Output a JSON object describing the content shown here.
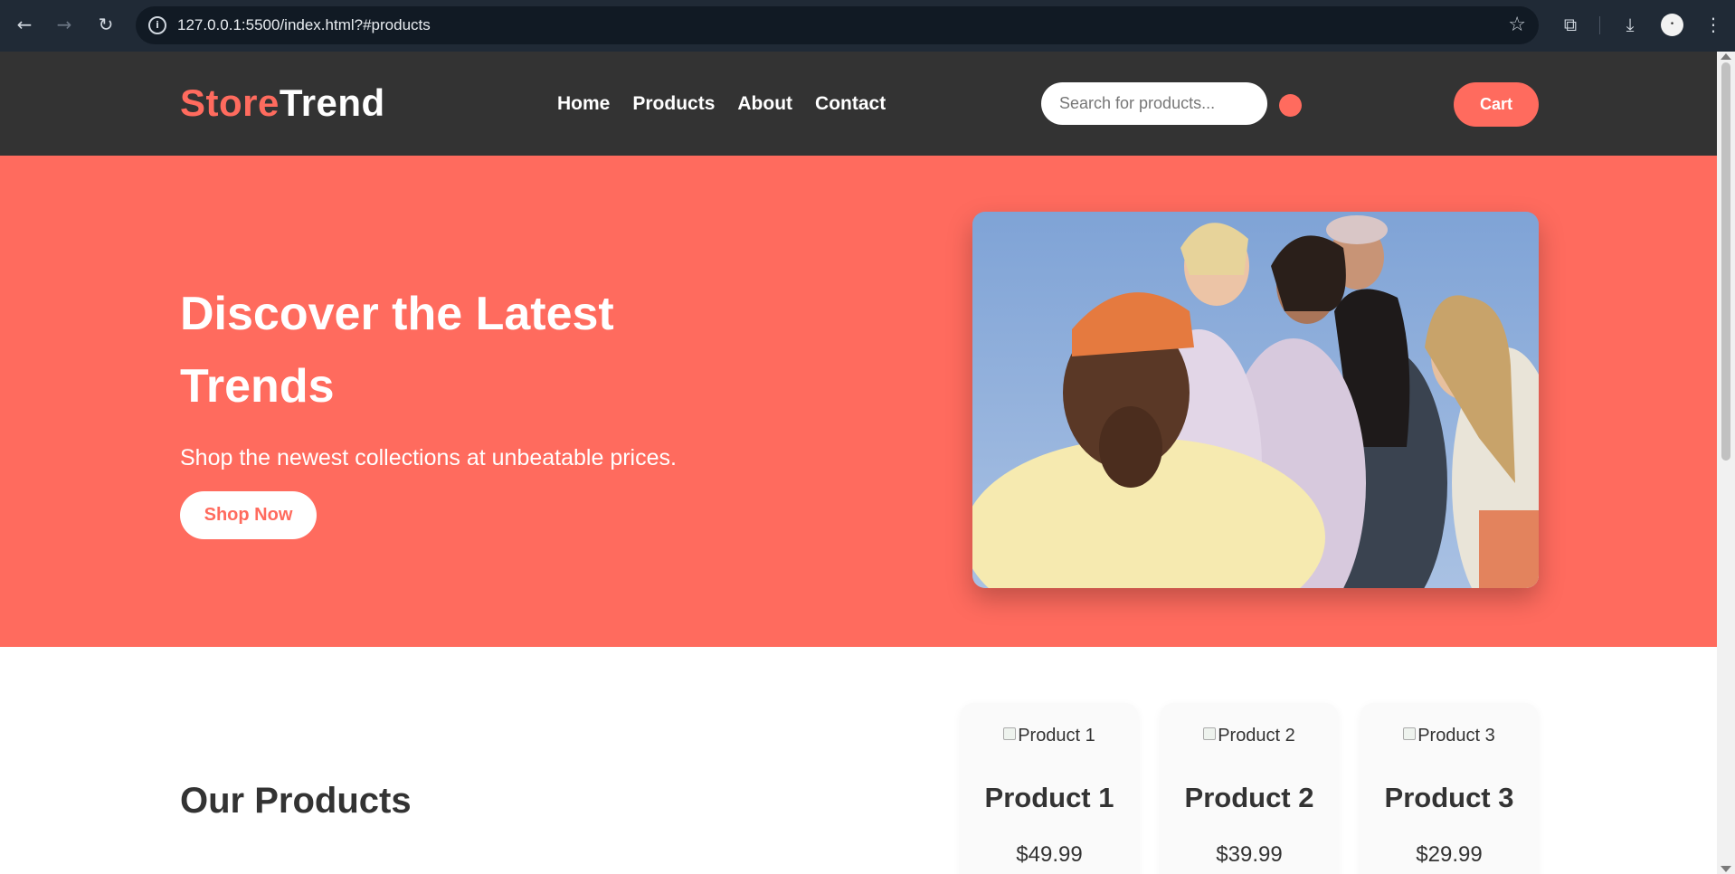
{
  "browser": {
    "url": "127.0.0.1:5500/index.html?#products",
    "back_icon": "arrow-left-icon",
    "forward_icon": "arrow-right-icon",
    "reload_icon": "reload-icon",
    "profile_initial": "•"
  },
  "header": {
    "logo_part1": "Store",
    "logo_part2": "Trend",
    "nav": [
      "Home",
      "Products",
      "About",
      "Contact"
    ],
    "search_placeholder": "Search for products...",
    "cart_label": "Cart"
  },
  "hero": {
    "title": "Discover the Latest Trends",
    "subtitle": "Shop the newest collections at unbeatable prices.",
    "cta": "Shop Now"
  },
  "products": {
    "heading": "Our Products",
    "items": [
      {
        "alt": "Product 1",
        "name": "Product 1",
        "price": "$49.99"
      },
      {
        "alt": "Product 2",
        "name": "Product 2",
        "price": "$39.99"
      },
      {
        "alt": "Product 3",
        "name": "Product 3",
        "price": "$29.99"
      }
    ]
  },
  "colors": {
    "accent": "#ff6b5e",
    "header_bg": "#333333",
    "chrome_bg": "#202a36"
  }
}
